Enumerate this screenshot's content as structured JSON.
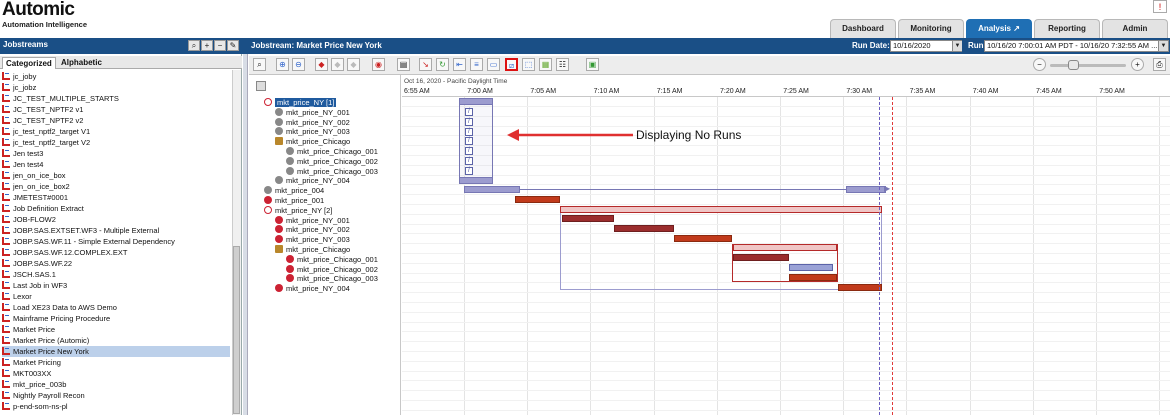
{
  "header": {
    "logo": "Automic",
    "tagline": "Automation Intelligence",
    "alert": "!",
    "tabs": [
      {
        "label": "Dashboard"
      },
      {
        "label": "Monitoring"
      },
      {
        "label": "Analysis"
      },
      {
        "label": "Reporting"
      },
      {
        "label": "Admin"
      }
    ]
  },
  "left_panel": {
    "title": "Jobstreams",
    "subtabs": [
      "Categorized",
      "Alphabetic"
    ],
    "items": [
      "jc_joby",
      "jc_jobz",
      "JC_TEST_MULTIPLE_STARTS",
      "JC_TEST_NPTF2 v1",
      "JC_TEST_NPTF2 v2",
      "jc_test_nptf2_target V1",
      "jc_test_nptf2_target V2",
      "Jen test3",
      "Jen test4",
      "jen_on_ice_box",
      "jen_on_ice_box2",
      "JMETEST#0001",
      "Job Definition Extract",
      "JOB-FLOW2",
      "JOBP.SAS.EXTSET.WF3 - Multiple External",
      "JOBP.SAS.WF.11 - Simple External Dependency",
      "JOBP.SAS.WF.12.COMPLEX.EXT",
      "JOBP.SAS.WF.22",
      "JSCH.SAS.1",
      "Last Job in WF3",
      "Lexor",
      "Load XE23 Data to AWS Demo",
      "Mainframe Pricing Procedure",
      "Market Price",
      "Market Price (Automic)",
      "Market Price New York",
      "Market Pricing",
      "MKT003XX",
      "mkt_price_003b",
      "Nightly Payroll Recon",
      "p-end-som-ns-pl"
    ],
    "selected": "Market Price New York"
  },
  "jobstream": {
    "title": "Jobstream: Market Price New York",
    "run_date_label": "Run Date:",
    "run_date": "10/16/2020",
    "run_label": "Run:",
    "run_value": "10/16/20 7:00:01 AM PDT - 10/16/20 7:32:55 AM ..."
  },
  "tree": [
    {
      "label": "mkt_price_NY [1]",
      "level": 0,
      "icon": "rings",
      "selected": true
    },
    {
      "label": "mkt_price_NY_001",
      "level": 1,
      "icon": "gray"
    },
    {
      "label": "mkt_price_NY_002",
      "level": 1,
      "icon": "gray"
    },
    {
      "label": "mkt_price_NY_003",
      "level": 1,
      "icon": "gray"
    },
    {
      "label": "mkt_price_Chicago",
      "level": 1,
      "icon": "fold"
    },
    {
      "label": "mkt_price_Chicago_001",
      "level": 2,
      "icon": "gray"
    },
    {
      "label": "mkt_price_Chicago_002",
      "level": 2,
      "icon": "gray"
    },
    {
      "label": "mkt_price_Chicago_003",
      "level": 2,
      "icon": "gray"
    },
    {
      "label": "mkt_price_NY_004",
      "level": 1,
      "icon": "gray"
    },
    {
      "label": "mkt_price_004",
      "level": 0,
      "icon": "gray"
    },
    {
      "label": "mkt_price_001",
      "level": 0,
      "icon": "red"
    },
    {
      "label": "mkt_price_NY [2]",
      "level": 0,
      "icon": "rings"
    },
    {
      "label": "mkt_price_NY_001",
      "level": 1,
      "icon": "red"
    },
    {
      "label": "mkt_price_NY_002",
      "level": 1,
      "icon": "red"
    },
    {
      "label": "mkt_price_NY_003",
      "level": 1,
      "icon": "red"
    },
    {
      "label": "mkt_price_Chicago",
      "level": 1,
      "icon": "fold"
    },
    {
      "label": "mkt_price_Chicago_001",
      "level": 2,
      "icon": "red"
    },
    {
      "label": "mkt_price_Chicago_002",
      "level": 2,
      "icon": "red"
    },
    {
      "label": "mkt_price_Chicago_003",
      "level": 2,
      "icon": "red"
    },
    {
      "label": "mkt_price_NY_004",
      "level": 1,
      "icon": "red"
    }
  ],
  "gantt": {
    "date_label": "Oct 16, 2020 - Pacific Daylight Time",
    "ticks": [
      "6:55 AM",
      "7:00 AM",
      "7:05 AM",
      "7:10 AM",
      "7:15 AM",
      "7:20 AM",
      "7:25 AM",
      "7:30 AM",
      "7:35 AM",
      "7:40 AM",
      "7:45 AM",
      "7:50 AM"
    ],
    "annotation": "Displaying No Runs"
  },
  "colors": {
    "brand_blue": "#1a4f86",
    "active_tab": "#1f6fb4",
    "bar_lavender": "#9c9ccf",
    "bar_red": "#c13a1b",
    "arrow_red": "#e03030"
  }
}
